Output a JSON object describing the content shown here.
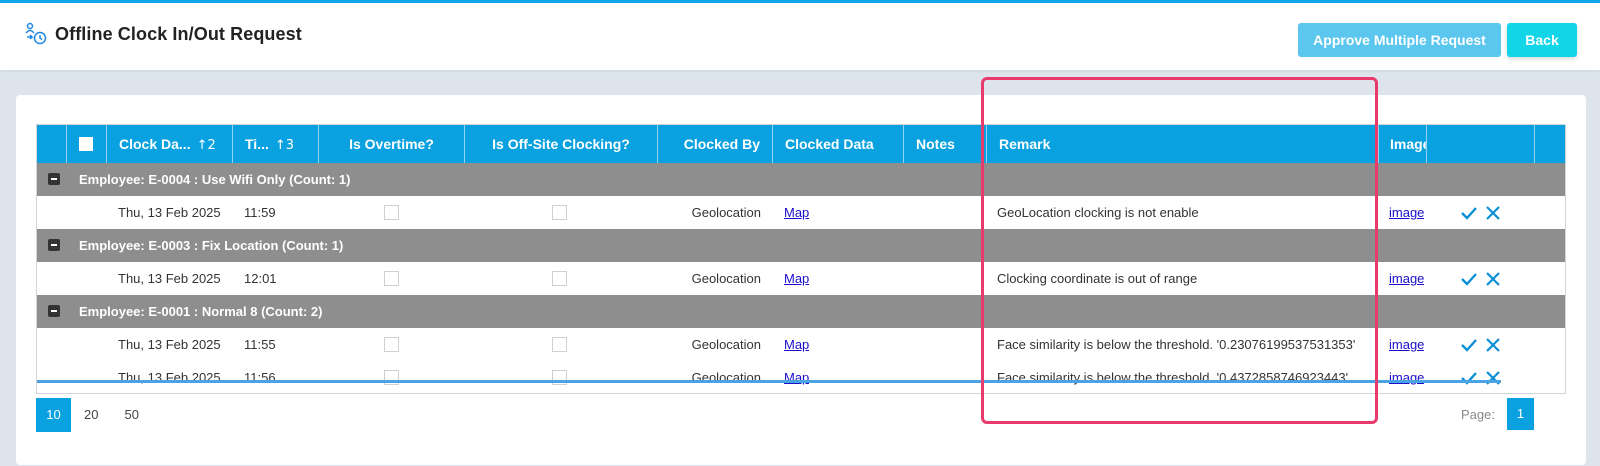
{
  "header": {
    "title": "Offline Clock In/Out Request",
    "approve_label": "Approve Multiple Request",
    "back_label": "Back"
  },
  "grid": {
    "columns": {
      "clock_date": "Clock Da...",
      "clock_date_sort": "↑2",
      "time": "Ti...",
      "time_sort": "↑3",
      "is_overtime": "Is Overtime?",
      "is_offsite": "Is Off-Site Clocking?",
      "clocked_by": "Clocked By",
      "clocked_data": "Clocked Data",
      "notes": "Notes",
      "remark": "Remark",
      "image": "Image"
    },
    "groups": [
      {
        "label": "Employee: E-0004 : Use Wifi Only (Count: 1)"
      },
      {
        "label": "Employee: E-0003 : Fix Location (Count: 1)"
      },
      {
        "label": "Employee: E-0001 : Normal 8 (Count: 2)"
      }
    ],
    "rows": [
      {
        "date": "Thu, 13 Feb 2025",
        "time": "11:59",
        "clocked_by": "Geolocation",
        "clocked_data": "Map",
        "remark": "GeoLocation clocking is not enable",
        "image": "image"
      },
      {
        "date": "Thu, 13 Feb 2025",
        "time": "12:01",
        "clocked_by": "Geolocation",
        "clocked_data": "Map",
        "remark": "Clocking coordinate is out of range",
        "image": "image"
      },
      {
        "date": "Thu, 13 Feb 2025",
        "time": "11:55",
        "clocked_by": "Geolocation",
        "clocked_data": "Map",
        "remark": "Face similarity is below the threshold. '0.23076199537531353'",
        "image": "image"
      },
      {
        "date": "Thu, 13 Feb 2025",
        "time": "11:56",
        "clocked_by": "Geolocation",
        "clocked_data": "Map",
        "remark": "Face similarity is below the threshold. '0.4372858746923443'",
        "image": "image"
      }
    ]
  },
  "pager": {
    "sizes": [
      "10",
      "20",
      "50"
    ],
    "active_size": "10",
    "page_label": "Page:",
    "current_page": "1"
  },
  "colors": {
    "accent": "#0aa1e0",
    "group_row": "#8e8e8e",
    "highlight": "#e83b6b"
  }
}
